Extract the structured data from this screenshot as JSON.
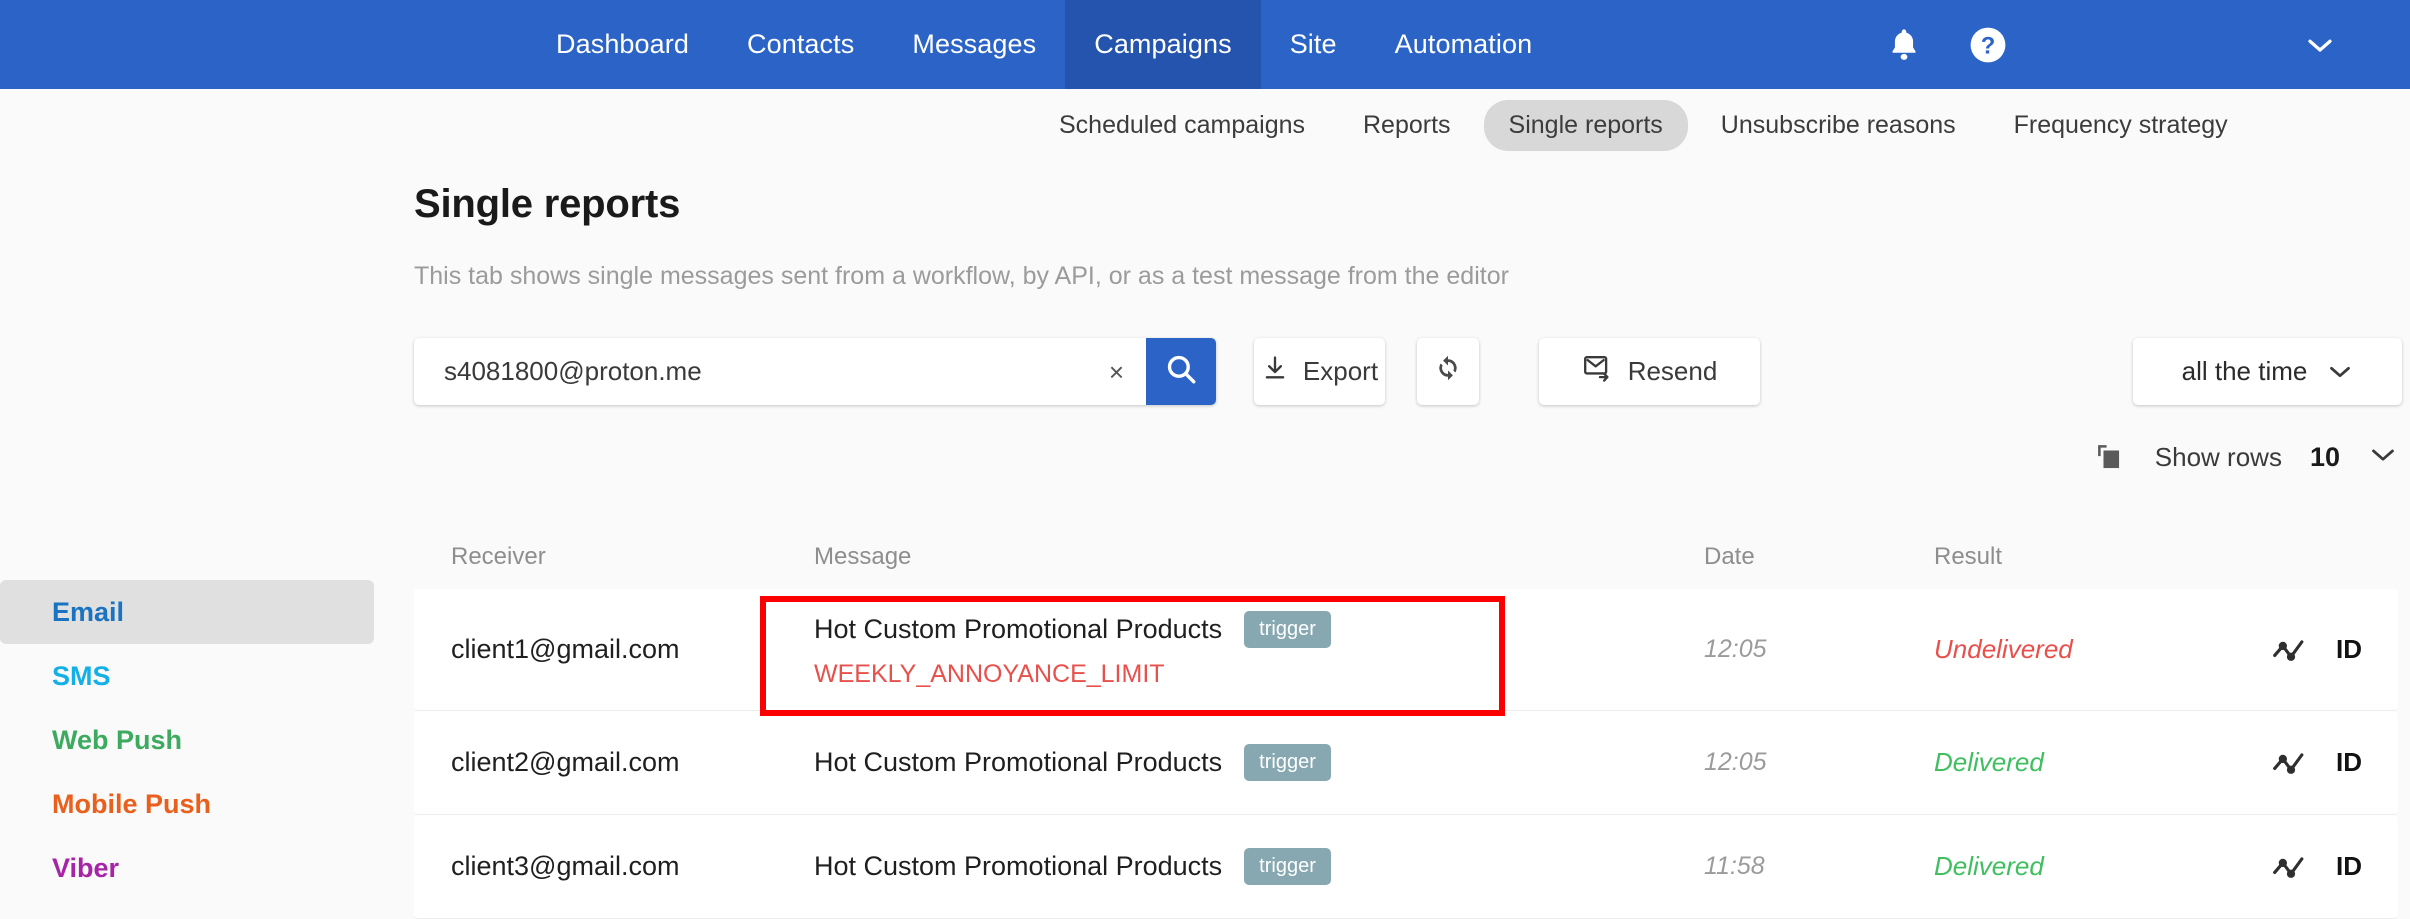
{
  "topnav": {
    "items": [
      {
        "label": "Dashboard",
        "active": false
      },
      {
        "label": "Contacts",
        "active": false
      },
      {
        "label": "Messages",
        "active": false
      },
      {
        "label": "Campaigns",
        "active": true
      },
      {
        "label": "Site",
        "active": false
      },
      {
        "label": "Automation",
        "active": false
      }
    ],
    "icons": {
      "notifications": "bell-icon",
      "help": "help-icon",
      "account_menu": "chevron-down-icon"
    },
    "background_color": "#2b63c7",
    "active_color": "#2454ae"
  },
  "subnav": {
    "items": [
      {
        "label": "Scheduled campaigns",
        "active": false
      },
      {
        "label": "Reports",
        "active": false
      },
      {
        "label": "Single reports",
        "active": true
      },
      {
        "label": "Unsubscribe reasons",
        "active": false
      },
      {
        "label": "Frequency strategy",
        "active": false
      }
    ]
  },
  "page": {
    "title": "Single reports",
    "subtitle": "This tab shows single messages sent from a workflow, by API, or as a test message from the editor"
  },
  "toolbar": {
    "search": {
      "value": "s4081800@proton.me",
      "placeholder": "",
      "clear_glyph": "×",
      "search_icon": "search-icon"
    },
    "export_label": "Export",
    "export_icon": "download-icon",
    "refresh_icon": "refresh-icon",
    "resend_label": "Resend",
    "resend_icon": "mail-forward-icon",
    "range_label": "all the time",
    "range_caret": "chevron-down-icon"
  },
  "rows_control": {
    "copy_icon": "copy-icon",
    "label": "Show rows",
    "value": "10",
    "caret": "chevron-down-icon"
  },
  "sidebar": {
    "items": [
      {
        "label": "Email",
        "color": "#1a73c0",
        "active": true
      },
      {
        "label": "SMS",
        "color": "#13b0e8",
        "active": false
      },
      {
        "label": "Web Push",
        "color": "#3caa5f",
        "active": false
      },
      {
        "label": "Mobile Push",
        "color": "#e8601c",
        "active": false
      },
      {
        "label": "Viber",
        "color": "#a625a6",
        "active": false
      }
    ]
  },
  "table": {
    "columns": [
      "Receiver",
      "Message",
      "Date",
      "Result"
    ],
    "rows": [
      {
        "receiver": "client1@gmail.com",
        "message": "Hot Custom Promotional Products",
        "badge": "trigger",
        "error": "WEEKLY_ANNOYANCE_LIMIT",
        "date": "12:05",
        "result": "Undelivered",
        "result_state": "undelivered",
        "stat_icon": "analytics-icon",
        "id_label": "ID"
      },
      {
        "receiver": "client2@gmail.com",
        "message": "Hot Custom Promotional Products",
        "badge": "trigger",
        "error": "",
        "date": "12:05",
        "result": "Delivered",
        "result_state": "delivered",
        "stat_icon": "analytics-icon",
        "id_label": "ID"
      },
      {
        "receiver": "client3@gmail.com",
        "message": "Hot Custom Promotional Products",
        "badge": "trigger",
        "error": "",
        "date": "11:58",
        "result": "Delivered",
        "result_state": "delivered",
        "stat_icon": "analytics-icon",
        "id_label": "ID"
      }
    ]
  },
  "annotation": {
    "highlight_color": "#fb0000"
  }
}
